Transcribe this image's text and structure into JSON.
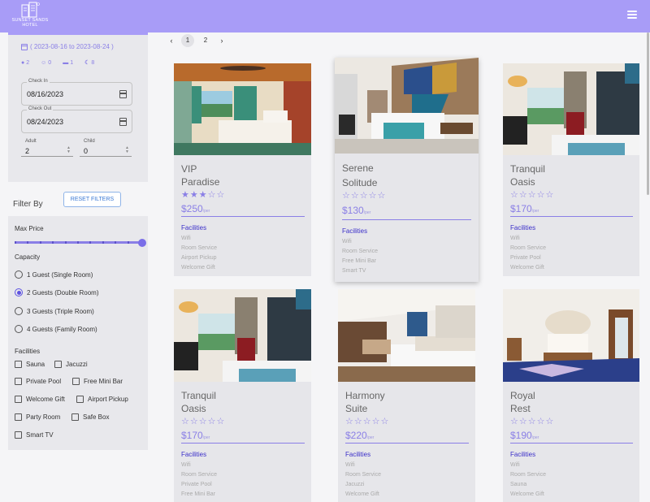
{
  "brand": {
    "name": "SUNSET SANDS",
    "sub": "HOTEL"
  },
  "booking": {
    "range": "( 2023-08-16 to 2023-08-24 )",
    "summary": {
      "adults": "2",
      "children": "0",
      "rooms": "1",
      "nights": "8"
    },
    "check_in_label": "Check In",
    "check_in_value": "08/16/2023",
    "check_out_label": "Check Out",
    "check_out_value": "08/24/2023",
    "adult_label": "Adult",
    "adult_value": "2",
    "child_label": "Child",
    "child_value": "0"
  },
  "filter": {
    "title": "Filter By",
    "reset_label": "RESET FILTERS",
    "max_price_label": "Max Price",
    "max_price_fraction": 1.0,
    "capacity_label": "Capacity",
    "capacity_options": [
      "1 Guest (Single Room)",
      "2 Guests (Double Room)",
      "3 Guests (Triple Room)",
      "4 Guests (Family Room)"
    ],
    "capacity_selected": 1,
    "facilities_label": "Facilities",
    "facilities": [
      "Sauna",
      "Jacuzzi",
      "Private Pool",
      "Free Mini Bar",
      "Welcome Gift",
      "Airport Pickup",
      "Party Room",
      "Safe Box",
      "Smart TV"
    ]
  },
  "pagination": {
    "pages": [
      "1",
      "2"
    ],
    "current": "1",
    "prev": "‹",
    "next": "›"
  },
  "accent_color": "#8a7fe6",
  "header_color": "#a89cf7",
  "rooms": [
    {
      "name1": "VIP",
      "name2": "Paradise",
      "stars": "★★★☆☆",
      "price": "$250",
      "unit": "/per",
      "facilities_label": "Facilities",
      "facilities": [
        "Wifi",
        "Room Service",
        "Airport Pickup",
        "Welcome Gift"
      ]
    },
    {
      "name1": "Serene",
      "name2": "Solitude",
      "stars": "☆☆☆☆☆",
      "price": "$130",
      "unit": "/per",
      "facilities_label": "Facilities",
      "facilities": [
        "Wifi",
        "Room Service",
        "Free Mini Bar",
        "Smart TV"
      ]
    },
    {
      "name1": "Tranquil",
      "name2": "Oasis",
      "stars": "☆☆☆☆☆",
      "price": "$170",
      "unit": "/per",
      "facilities_label": "Facilities",
      "facilities": [
        "Wifi",
        "Room Service",
        "Private Pool",
        "Welcome Gift"
      ]
    },
    {
      "name1": "Tranquil",
      "name2": "Oasis",
      "stars": "☆☆☆☆☆",
      "price": "$170",
      "unit": "/per",
      "facilities_label": "Facilities",
      "facilities": [
        "Wifi",
        "Room Service",
        "Private Pool",
        "Free Mini Bar"
      ]
    },
    {
      "name1": "Harmony",
      "name2": "Suite",
      "stars": "☆☆☆☆☆",
      "price": "$220",
      "unit": "/per",
      "facilities_label": "Facilities",
      "facilities": [
        "Wifi",
        "Room Service",
        "Jacuzzi",
        "Welcome Gift"
      ]
    },
    {
      "name1": "Royal",
      "name2": "Rest",
      "stars": "☆☆☆☆☆",
      "price": "$190",
      "unit": "/per",
      "facilities_label": "Facilities",
      "facilities": [
        "Wifi",
        "Room Service",
        "Sauna",
        "Welcome Gift"
      ]
    }
  ]
}
